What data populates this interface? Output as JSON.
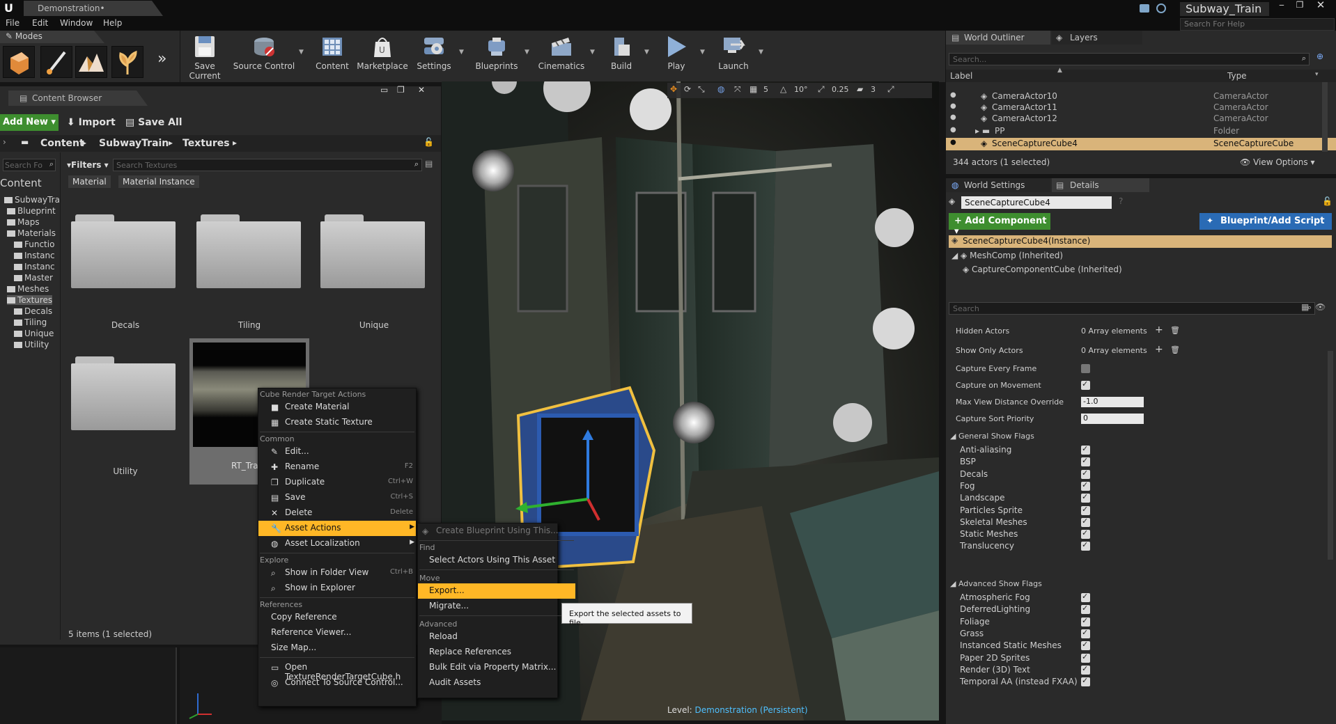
{
  "titlebar": {
    "doc_tab": "Demonstration•",
    "project": "Subway_Train",
    "help_search_placeholder": "Search For Help"
  },
  "menu": [
    "File",
    "Edit",
    "Window",
    "Help"
  ],
  "modes": {
    "title": "Modes"
  },
  "toolbar": [
    {
      "label": "Save Current",
      "icon": "save-icon"
    },
    {
      "label": "Source Control",
      "icon": "source-control-icon"
    },
    {
      "label": "Content",
      "icon": "content-icon"
    },
    {
      "label": "Marketplace",
      "icon": "marketplace-icon"
    },
    {
      "label": "Settings",
      "icon": "settings-icon"
    },
    {
      "label": "Blueprints",
      "icon": "blueprints-icon"
    },
    {
      "label": "Cinematics",
      "icon": "cinematics-icon"
    },
    {
      "label": "Build",
      "icon": "build-icon"
    },
    {
      "label": "Play",
      "icon": "play-icon"
    },
    {
      "label": "Launch",
      "icon": "launch-icon"
    }
  ],
  "content_browser": {
    "tab": "Content Browser",
    "add_new": "Add New",
    "import": "Import",
    "save_all": "Save All",
    "path": [
      "Content",
      "SubwayTrain",
      "Textures"
    ],
    "search_paths_placeholder": "Search Fo",
    "filters": "Filters",
    "search_placeholder": "Search Textures",
    "filter_chips": [
      "Material",
      "Material Instance"
    ],
    "tree": [
      {
        "label": "Content",
        "level": 0
      },
      {
        "label": "SubwayTra",
        "level": 1
      },
      {
        "label": "Blueprint",
        "level": 2
      },
      {
        "label": "Maps",
        "level": 2
      },
      {
        "label": "Materials",
        "level": 2
      },
      {
        "label": "Functio",
        "level": 3
      },
      {
        "label": "Instanc",
        "level": 3
      },
      {
        "label": "Instanc",
        "level": 3
      },
      {
        "label": "Master",
        "level": 3
      },
      {
        "label": "Meshes",
        "level": 2
      },
      {
        "label": "Textures",
        "level": 2
      },
      {
        "label": "Decals",
        "level": 3
      },
      {
        "label": "Tiling",
        "level": 3
      },
      {
        "label": "Unique",
        "level": 3
      },
      {
        "label": "Utility",
        "level": 3
      }
    ],
    "folders": [
      "Decals",
      "Tiling",
      "Unique",
      "Utility"
    ],
    "asset_label": "RT_Tra",
    "status": "5 items (1 selected)"
  },
  "viewport": {
    "snap_values": [
      "5",
      "10°",
      "0.25",
      "3"
    ],
    "level_label": "Level:",
    "level_name": "Demonstration (Persistent)"
  },
  "context_menu": {
    "sections": [
      {
        "header": "Cube Render Target Actions",
        "items": [
          {
            "label": "Create Material",
            "shortcut": ""
          },
          {
            "label": "Create Static Texture",
            "shortcut": ""
          }
        ]
      },
      {
        "header": "Common",
        "items": [
          {
            "label": "Edit...",
            "shortcut": ""
          },
          {
            "label": "Rename",
            "shortcut": "F2"
          },
          {
            "label": "Duplicate",
            "shortcut": "Ctrl+W"
          },
          {
            "label": "Save",
            "shortcut": "Ctrl+S"
          },
          {
            "label": "Delete",
            "shortcut": "Delete"
          },
          {
            "label": "Asset Actions",
            "shortcut": ""
          },
          {
            "label": "Asset Localization",
            "shortcut": ""
          }
        ]
      },
      {
        "header": "Explore",
        "items": [
          {
            "label": "Show in Folder View",
            "shortcut": "Ctrl+B"
          },
          {
            "label": "Show in Explorer",
            "shortcut": ""
          }
        ]
      },
      {
        "header": "References",
        "items": [
          {
            "label": "Copy Reference",
            "shortcut": ""
          },
          {
            "label": "Reference Viewer...",
            "shortcut": ""
          },
          {
            "label": "Size Map...",
            "shortcut": ""
          }
        ]
      },
      {
        "header": "",
        "items": [
          {
            "label": "Open TextureRenderTargetCube.h",
            "shortcut": ""
          },
          {
            "label": "Connect To Source Control...",
            "shortcut": ""
          }
        ]
      }
    ]
  },
  "submenu": {
    "create_blueprint": "Create Blueprint Using This...",
    "find_header": "Find",
    "select_actors": "Select Actors Using This Asset",
    "move_header": "Move",
    "export": "Export...",
    "migrate": "Migrate...",
    "advanced_header": "Advanced",
    "reload": "Reload",
    "replace_references": "Replace References",
    "bulk_edit": "Bulk Edit via Property Matrix...",
    "audit_assets": "Audit Assets"
  },
  "tooltip": "Export the selected assets to file.",
  "outliner": {
    "tab1": "World Outliner",
    "tab2": "Layers",
    "search_placeholder": "Search...",
    "col_label": "Label",
    "col_type": "Type",
    "rows": [
      {
        "label": "CameraActor10",
        "type": "CameraActor"
      },
      {
        "label": "CameraActor11",
        "type": "CameraActor"
      },
      {
        "label": "CameraActor12",
        "type": "CameraActor"
      },
      {
        "label": "PP",
        "type": "Folder"
      },
      {
        "label": "SceneCaptureCube4",
        "type": "SceneCaptureCube"
      }
    ],
    "status": "344 actors (1 selected)",
    "view_options": "View Options"
  },
  "details": {
    "tab1": "World Settings",
    "tab2": "Details",
    "name": "SceneCaptureCube4",
    "add_component": "Add Component",
    "blueprint_button": "Blueprint/Add Script",
    "instance": "SceneCaptureCube4(Instance)",
    "components": [
      "MeshComp (Inherited)",
      "CaptureComponentCube (Inherited)"
    ],
    "search_placeholder": "Search",
    "props": [
      {
        "label": "Hidden Actors",
        "value": "0 Array elements"
      },
      {
        "label": "Show Only Actors",
        "value": "0 Array elements"
      },
      {
        "label": "Capture Every Frame",
        "value": ""
      },
      {
        "label": "Capture on Movement",
        "value": ""
      },
      {
        "label": "Max View Distance Override",
        "value": "-1.0"
      },
      {
        "label": "Capture Sort Priority",
        "value": "0"
      }
    ],
    "general_flags_header": "General Show Flags",
    "general_flags": [
      "Anti-aliasing",
      "BSP",
      "Decals",
      "Fog",
      "Landscape",
      "Particles Sprite",
      "Skeletal Meshes",
      "Static Meshes",
      "Translucency"
    ],
    "advanced_flags_header": "Advanced Show Flags",
    "advanced_flags": [
      "Atmospheric Fog",
      "DeferredLighting",
      "Foliage",
      "Grass",
      "Instanced Static Meshes",
      "Paper 2D Sprites",
      "Render (3D) Text",
      "Temporal AA (instead FXAA)"
    ]
  },
  "colors": {
    "accent": "#ffb726",
    "green": "#3e8e2f",
    "blue": "#2a6bb5",
    "selected_row": "#d9b47a"
  }
}
